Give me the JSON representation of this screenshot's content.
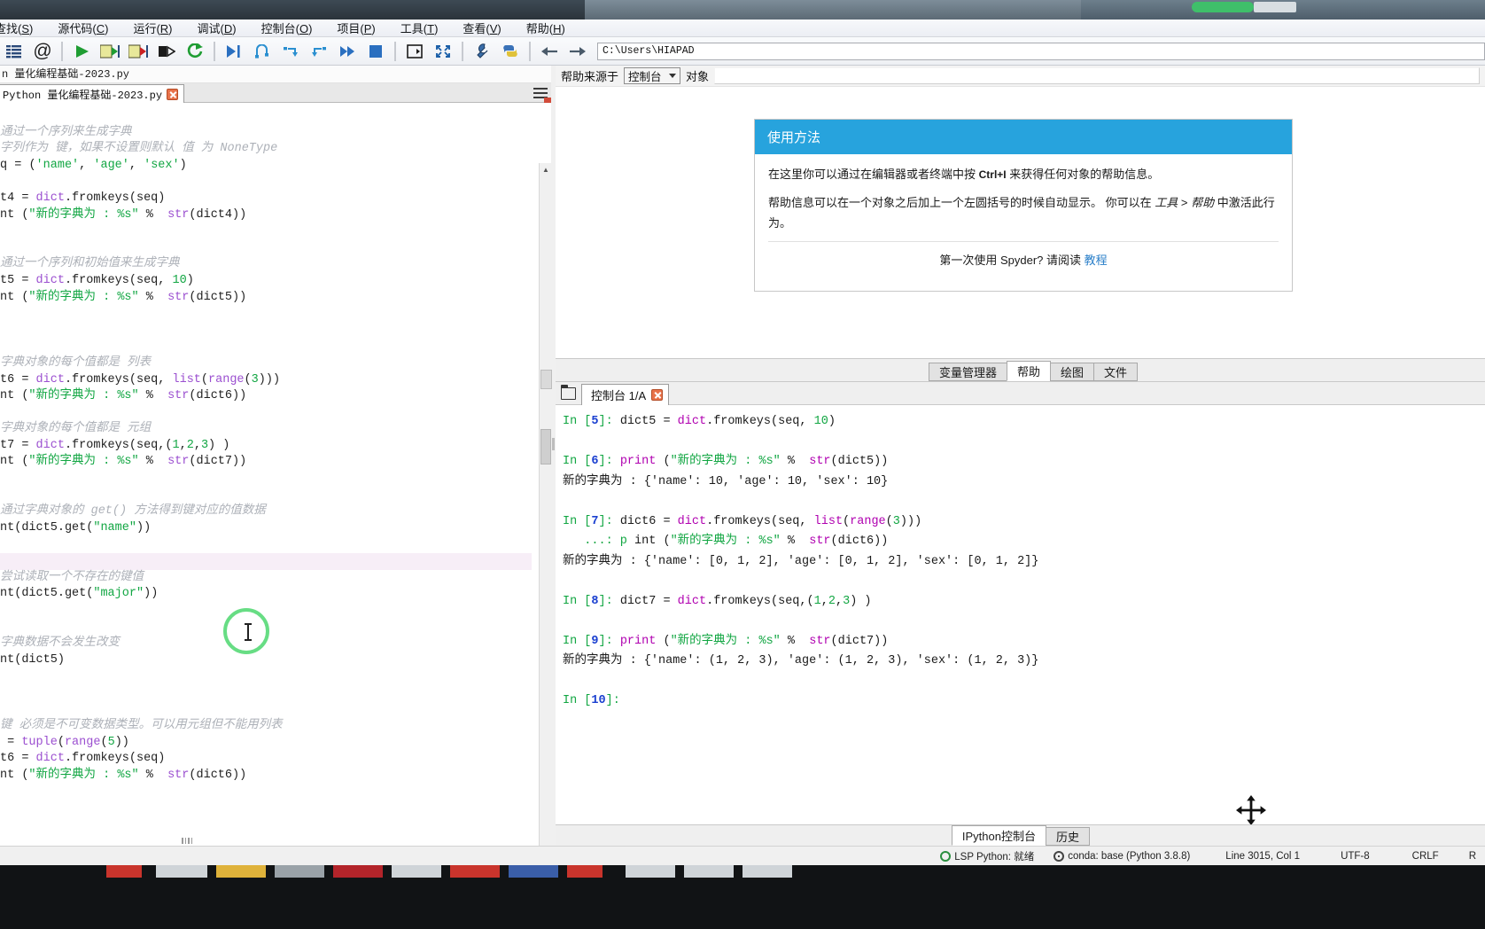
{
  "window": {
    "app": "Spyder",
    "path": "C:\\Users\\HIAPAD"
  },
  "menubar": {
    "items": [
      {
        "label": "查找(S)",
        "accel": "S"
      },
      {
        "label": "源代码(C)",
        "accel": "C"
      },
      {
        "label": "运行(R)",
        "accel": "R"
      },
      {
        "label": "调试(D)",
        "accel": "D"
      },
      {
        "label": "控制台(O)",
        "accel": "O"
      },
      {
        "label": "项目(P)",
        "accel": "P"
      },
      {
        "label": "工具(T)",
        "accel": "T"
      },
      {
        "label": "查看(V)",
        "accel": "V"
      },
      {
        "label": "帮助(H)",
        "accel": "H"
      }
    ]
  },
  "toolbar": {
    "icons": [
      "file-list-icon",
      "at-icon",
      "run-file-icon",
      "run-cell-icon",
      "run-cell-advance-icon",
      "run-selection-icon",
      "rerun-icon",
      "debug-file-icon",
      "debug-step-icon",
      "debug-stepin-icon",
      "debug-stepout-icon",
      "debug-continue-icon",
      "debug-stop-icon",
      "open-preferences-icon",
      "maximize-pane-icon",
      "wrench-icon",
      "python-path-icon"
    ],
    "back_icon": "arrow-left-icon",
    "forward_icon": "arrow-right-icon",
    "path_value": "C:\\Users\\HIAPAD"
  },
  "editor": {
    "file_label": "n 量化编程基础-2023.py",
    "tab_label": "Python 量化编程基础-2023.py",
    "tab_close": "close-icon",
    "options_icon": "hamburger-icon",
    "lines": [
      {
        "t": "blank",
        "text": ""
      },
      {
        "t": "comment",
        "text": "通过一个序列来生成字典"
      },
      {
        "t": "comment",
        "text": "字列作为 键，如果不设置则默认 值 为 NoneType"
      },
      {
        "t": "code",
        "text": "q = ('name', 'age', 'sex')"
      },
      {
        "t": "blank",
        "text": ""
      },
      {
        "t": "code",
        "text": "t4 = dict.fromkeys(seq)"
      },
      {
        "t": "code",
        "text": "nt (\"新的字典为 : %s\" %  str(dict4))"
      },
      {
        "t": "blank",
        "text": ""
      },
      {
        "t": "blank",
        "text": ""
      },
      {
        "t": "comment",
        "text": "通过一个序列和初始值来生成字典"
      },
      {
        "t": "code",
        "text": "t5 = dict.fromkeys(seq, 10)"
      },
      {
        "t": "code",
        "text": "nt (\"新的字典为 : %s\" %  str(dict5))"
      },
      {
        "t": "blank",
        "text": ""
      },
      {
        "t": "blank",
        "text": ""
      },
      {
        "t": "blank",
        "text": ""
      },
      {
        "t": "comment",
        "text": "字典对象的每个值都是 列表"
      },
      {
        "t": "code",
        "text": "t6 = dict.fromkeys(seq, list(range(3)))"
      },
      {
        "t": "code",
        "text": "nt (\"新的字典为 : %s\" %  str(dict6))"
      },
      {
        "t": "blank",
        "text": ""
      },
      {
        "t": "comment",
        "text": "字典对象的每个值都是 元组"
      },
      {
        "t": "code",
        "text": "t7 = dict.fromkeys(seq,(1,2,3) )"
      },
      {
        "t": "code",
        "text": "nt (\"新的字典为 : %s\" %  str(dict7))"
      },
      {
        "t": "blank",
        "text": ""
      },
      {
        "t": "blank",
        "text": ""
      },
      {
        "t": "comment",
        "text": "通过字典对象的 get() 方法得到键对应的值数据"
      },
      {
        "t": "code",
        "text": "nt(dict5.get(\"name\"))"
      },
      {
        "t": "blank",
        "text": ""
      },
      {
        "t": "cursor",
        "text": ""
      },
      {
        "t": "comment",
        "text": "尝试读取一个不存在的键值"
      },
      {
        "t": "code",
        "text": "nt(dict5.get(\"major\"))"
      },
      {
        "t": "blank",
        "text": ""
      },
      {
        "t": "blank",
        "text": ""
      },
      {
        "t": "comment",
        "text": "字典数据不会发生改变"
      },
      {
        "t": "code",
        "text": "nt(dict5)"
      },
      {
        "t": "blank",
        "text": ""
      },
      {
        "t": "blank",
        "text": ""
      },
      {
        "t": "blank",
        "text": ""
      },
      {
        "t": "comment",
        "text": "键 必须是不可变数据类型。可以用元组但不能用列表"
      },
      {
        "t": "code",
        "text": " = tuple(range(5))"
      },
      {
        "t": "code",
        "text": "t6 = dict.fromkeys(seq)"
      },
      {
        "t": "code",
        "text": "nt (\"新的字典为 : %s\" %  str(dict6))"
      }
    ]
  },
  "help": {
    "source_label": "帮助来源于",
    "source_value": "控制台",
    "object_label": "对象",
    "object_value": "",
    "card_title": "使用方法",
    "card_p1_a": "在这里你可以通过在编辑器或者终端中按 ",
    "card_p1_kbd": "Ctrl+I",
    "card_p1_b": " 来获得任何对象的帮助信息。",
    "card_p2_a": "帮助信息可以在一个对象之后加上一个左圆括号的时候自动显示。 你可以在 ",
    "card_p2_it1": "工具",
    "card_p2_sep": " > ",
    "card_p2_it2": "帮助",
    "card_p2_b": " 中激活此行为。",
    "card_foot_a": "第一次使用 Spyder? 请阅读 ",
    "card_foot_link": "教程",
    "tabs": [
      {
        "label": "变量管理器",
        "active": false
      },
      {
        "label": "帮助",
        "active": true
      },
      {
        "label": "绘图",
        "active": false
      },
      {
        "label": "文件",
        "active": false
      }
    ]
  },
  "console": {
    "new_console_icon": "new-console-icon",
    "tab_label": "控制台 1/A",
    "tab_close": "close-icon",
    "lines": [
      {
        "prompt": "In",
        "n": "5",
        "code": "dict5 = dict.fromkeys(seq, 10)"
      },
      {
        "blank": true
      },
      {
        "prompt": "In",
        "n": "6",
        "code": "print (\"新的字典为 : %s\" %  str(dict5))"
      },
      {
        "output": "新的字典为 : {'name': 10, 'age': 10, 'sex': 10}"
      },
      {
        "blank": true
      },
      {
        "prompt": "In",
        "n": "7",
        "code": "dict6 = dict.fromkeys(seq, list(range(3)))"
      },
      {
        "cont": "...: print (\"新的字典为 : %s\" %  str(dict6))"
      },
      {
        "output": "新的字典为 : {'name': [0, 1, 2], 'age': [0, 1, 2], 'sex': [0, 1, 2]}"
      },
      {
        "blank": true
      },
      {
        "prompt": "In",
        "n": "8",
        "code": "dict7 = dict.fromkeys(seq,(1,2,3) )"
      },
      {
        "blank": true
      },
      {
        "prompt": "In",
        "n": "9",
        "code": "print (\"新的字典为 : %s\" %  str(dict7))"
      },
      {
        "output": "新的字典为 : {'name': (1, 2, 3), 'age': (1, 2, 3), 'sex': (1, 2, 3)}"
      },
      {
        "blank": true
      },
      {
        "prompt": "In",
        "n": "10",
        "code": ""
      }
    ],
    "bottom_tabs": [
      {
        "label": "IPython控制台",
        "active": true
      },
      {
        "label": "历史",
        "active": false
      }
    ]
  },
  "statusbar": {
    "lsp": "LSP Python: 就绪",
    "conda": "conda: base (Python 3.8.8)",
    "position": "Line 3015, Col 1",
    "encoding": "UTF-8",
    "eol": "CRLF",
    "rw": "R"
  },
  "cursor": {
    "click_ring": "click-highlight-ring",
    "ibeam": "text-cursor",
    "move": "move-cursor"
  },
  "colors": {
    "accent": "#27a3dd",
    "link": "#2a7fc9",
    "comment": "#adb1b8",
    "string": "#11a642",
    "keyword": "#b000b0",
    "builtin": "#9b4fd0",
    "click_ring": "#67dd84",
    "close_btn": "#e8724a"
  }
}
